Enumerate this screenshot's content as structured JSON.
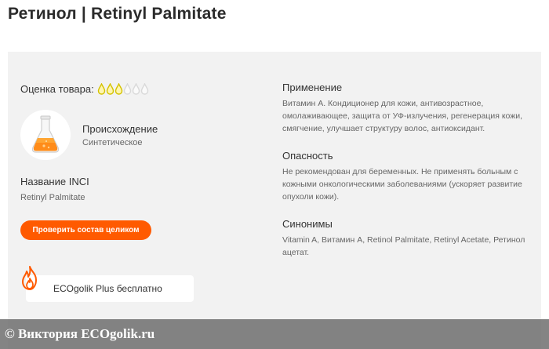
{
  "page": {
    "title": "Ретинол | Retinyl Palmitate"
  },
  "rating": {
    "label": "Оценка товара:",
    "value": 3,
    "max": 6
  },
  "origin": {
    "label": "Происхождение",
    "value": "Синтетическое",
    "icon": "flask-icon"
  },
  "inci": {
    "label": "Название INCI",
    "value": "Retinyl Palmitate"
  },
  "buttons": {
    "check_composition": "Проверить состав целиком"
  },
  "eco": {
    "text": "ECOgolik Plus бесплатно",
    "icon": "flame-icon"
  },
  "sections": {
    "usage": {
      "title": "Применение",
      "text": "Витамин А. Кондиционер для кожи, антивозрастное, омолаживающее, защита от УФ-излучения, регенерация кожи, смягчение, улучшает структуру волос, антиоксидант."
    },
    "danger": {
      "title": "Опасность",
      "text": "Не рекомендован для беременных. Не применять больным с кожными онкологическими заболеваниями (ускоряет развитие опухоли кожи)."
    },
    "synonyms": {
      "title": "Синонимы",
      "text": "Vitamin A, Витамин А, Retinol Palmitate, Retinyl Acetate, Ретинол ацетат."
    }
  },
  "watermark": {
    "text": "© Виктория ECOgolik.ru"
  },
  "colors": {
    "accent": "#ff5a00",
    "drop_active": "#d4c200",
    "drop_inactive": "#d9d9d9",
    "card_bg": "#f2f2f2"
  }
}
